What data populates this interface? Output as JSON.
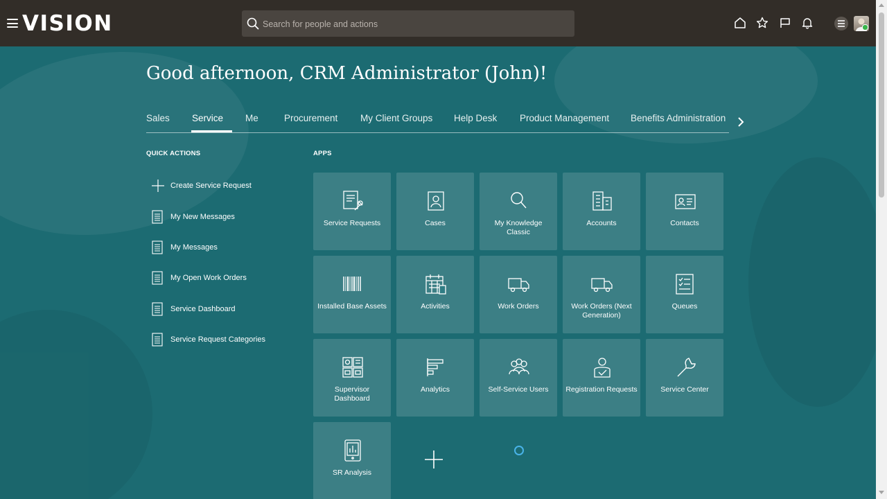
{
  "header": {
    "logo": "VISION",
    "search_placeholder": "Search for people and actions",
    "icons": [
      "home-icon",
      "star-icon",
      "flag-icon",
      "bell-icon",
      "settings-icon",
      "avatar"
    ]
  },
  "greeting": "Good afternoon, CRM Administrator (John)!",
  "tabs": [
    {
      "label": "Sales",
      "active": false
    },
    {
      "label": "Service",
      "active": true
    },
    {
      "label": "Me",
      "active": false
    },
    {
      "label": "Procurement",
      "active": false
    },
    {
      "label": "My Client Groups",
      "active": false
    },
    {
      "label": "Help Desk",
      "active": false
    },
    {
      "label": "Product Management",
      "active": false
    },
    {
      "label": "Benefits Administration",
      "active": false
    }
  ],
  "quick_actions": {
    "title": "QUICK ACTIONS",
    "items": [
      {
        "label": "Create Service Request",
        "icon": "plus-icon"
      },
      {
        "label": "My New Messages",
        "icon": "document-icon"
      },
      {
        "label": "My Messages",
        "icon": "document-icon"
      },
      {
        "label": "My Open Work Orders",
        "icon": "document-icon"
      },
      {
        "label": "Service Dashboard",
        "icon": "document-icon"
      },
      {
        "label": "Service Request Categories",
        "icon": "document-icon"
      }
    ]
  },
  "apps": {
    "title": "APPS",
    "items": [
      {
        "label": "Service Requests",
        "icon": "service-request-icon"
      },
      {
        "label": "Cases",
        "icon": "case-icon"
      },
      {
        "label": "My Knowledge Classic",
        "icon": "search-icon"
      },
      {
        "label": "Accounts",
        "icon": "building-icon"
      },
      {
        "label": "Contacts",
        "icon": "contact-card-icon"
      },
      {
        "label": "Installed Base Assets",
        "icon": "barcode-icon"
      },
      {
        "label": "Activities",
        "icon": "calendar-icon"
      },
      {
        "label": "Work Orders",
        "icon": "truck-icon"
      },
      {
        "label": "Work Orders (Next Generation)",
        "icon": "truck-icon"
      },
      {
        "label": "Queues",
        "icon": "checklist-icon"
      },
      {
        "label": "Supervisor Dashboard",
        "icon": "dashboard-icon"
      },
      {
        "label": "Analytics",
        "icon": "analytics-icon"
      },
      {
        "label": "Self-Service Users",
        "icon": "users-icon"
      },
      {
        "label": "Registration Requests",
        "icon": "user-check-icon"
      },
      {
        "label": "Service Center",
        "icon": "wrench-icon"
      },
      {
        "label": "SR Analysis",
        "icon": "tablet-chart-icon"
      }
    ]
  }
}
